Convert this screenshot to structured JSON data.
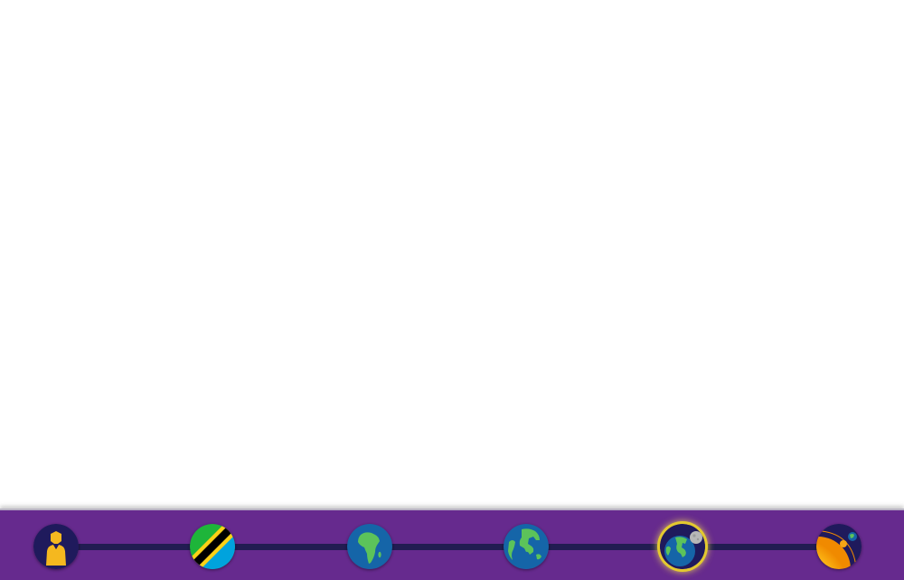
{
  "navigation": {
    "scales": [
      {
        "icon": "person-icon",
        "active": false
      },
      {
        "icon": "tanzania-flag-icon",
        "active": false
      },
      {
        "icon": "africa-globe-icon",
        "active": false
      },
      {
        "icon": "earth-globe-icon",
        "active": false
      },
      {
        "icon": "earth-moon-icon",
        "active": true
      },
      {
        "icon": "sun-earth-icon",
        "active": false
      }
    ]
  },
  "colors": {
    "nav_background": "#662a8e",
    "track": "#221c52",
    "active_ring": "#e3c92f",
    "button_dark": "#1f1a5c",
    "ocean": "#1565a8",
    "land": "#5cc35a",
    "person": "#f5b81f"
  }
}
